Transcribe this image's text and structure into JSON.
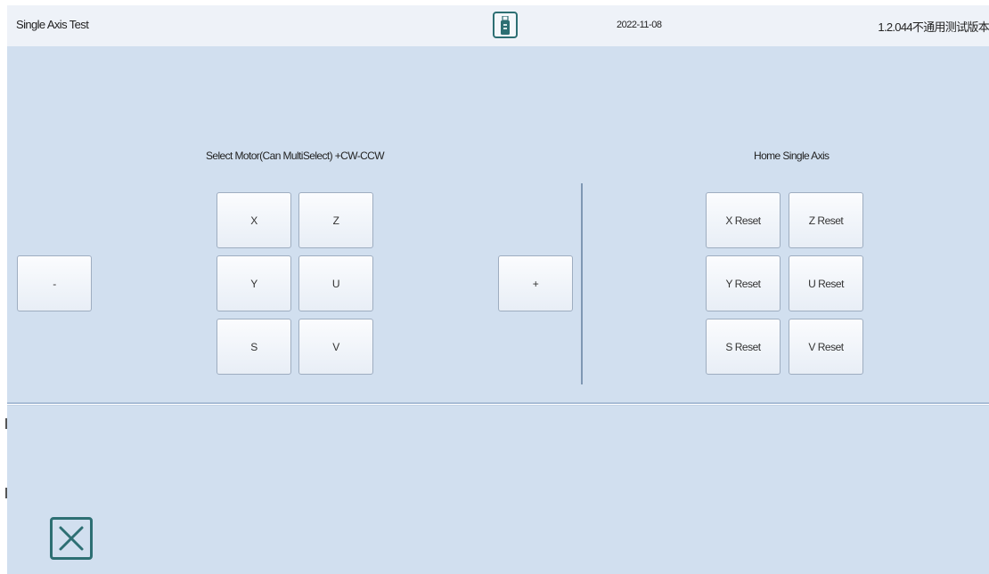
{
  "header": {
    "title": "Single Axis Test",
    "usb_icon": "usb-drive-icon",
    "date": "2022-11-08",
    "version": "1.2.044不通用测试版本"
  },
  "motor_select": {
    "label": "Select Motor(Can MultiSelect) +CW-CCW",
    "minus_label": "-",
    "plus_label": "+",
    "axes": [
      "X",
      "Z",
      "Y",
      "U",
      "S",
      "V"
    ]
  },
  "home": {
    "label": "Home Single Axis",
    "buttons": [
      "X Reset",
      "Z Reset",
      "Y Reset",
      "U Reset",
      "S Reset",
      "V Reset"
    ]
  },
  "footer": {
    "close_icon": "close-icon"
  },
  "colors": {
    "panel_bg": "#d1dfef",
    "header_bg": "#eef2f8",
    "accent": "#2d6f73"
  }
}
